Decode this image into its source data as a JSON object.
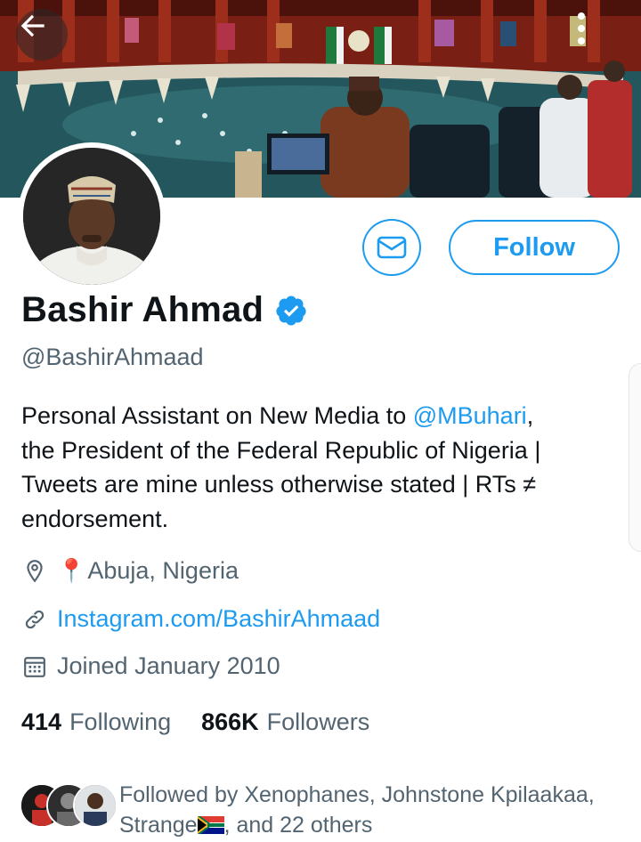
{
  "profile": {
    "name": "Bashir Ahmad",
    "handle": "@BashirAhmaad",
    "bio": {
      "line1_prefix": "Personal Assistant on New Media to ",
      "line1_mention": "@MBuhari",
      "line1_suffix": ",",
      "line2": "the President of the Federal Republic of Nigeria |",
      "line3": "Tweets are mine unless otherwise stated | RTs ≠",
      "line4": "endorsement."
    },
    "location_emoji": "📍",
    "location": "Abuja, Nigeria",
    "website": "Instagram.com/BashirAhmaad",
    "joined": "Joined January 2010",
    "following_count": "414",
    "following_label": "Following",
    "followers_count": "866K",
    "followers_label": "Followers",
    "followed_by_line1": "Followed by Xenophanes, Johnstone Kpilaakaa,",
    "followed_by_line2_prefix": "Strange",
    "followed_by_line2_suffix": ", and 22 others"
  },
  "actions": {
    "follow_label": "Follow"
  },
  "icons": {
    "back": "arrow-left-icon",
    "more": "more-vertical-icon",
    "message": "envelope-icon",
    "verified": "verified-badge-icon",
    "location": "location-pin-icon",
    "link": "link-icon",
    "calendar": "calendar-icon",
    "flag": "south-africa-flag"
  },
  "colors": {
    "accent": "#1d9bf0",
    "text_primary": "#0f1419",
    "text_secondary": "#536471"
  }
}
